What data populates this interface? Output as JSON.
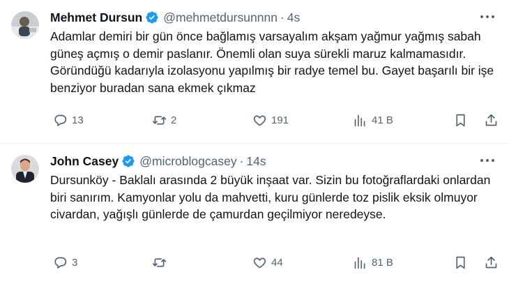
{
  "colors": {
    "accent": "#1d9bf0",
    "text": "#0f1419",
    "muted": "#536471",
    "divider": "#eff3f4"
  },
  "tweets": [
    {
      "name": "Mehmet Dursun",
      "handle": "@mehmetdursunnnn",
      "time": "4s",
      "text": "Adamlar demiri bir gün önce bağlamış varsayalım akşam yağmur yağmış sabah güneş açmış o demir paslanır. Önemli olan suya sürekli maruz kalmamasıdır. Göründüğü kadarıyla izolasyonu yapılmış bir radye temel bu. Gayet başarılı bir işe benziyor buradan sana ekmek çıkmaz",
      "replies": "13",
      "retweets": "2",
      "likes": "191",
      "views": "41 B"
    },
    {
      "name": "John Casey",
      "handle": "@microblogcasey",
      "time": "14s",
      "text": "Dursunköy - Baklalı arasında 2 büyük inşaat var. Sizin bu fotoğraflardaki onlardan biri sanırım. Kamyonlar yolu da mahvetti, kuru günlerde toz pislik eksik olmuyor civardan, yağışlı günlerde de çamurdan geçilmiyor neredeyse.",
      "replies": "3",
      "retweets": "",
      "likes": "44",
      "views": "81 B"
    }
  ],
  "separator": "·"
}
